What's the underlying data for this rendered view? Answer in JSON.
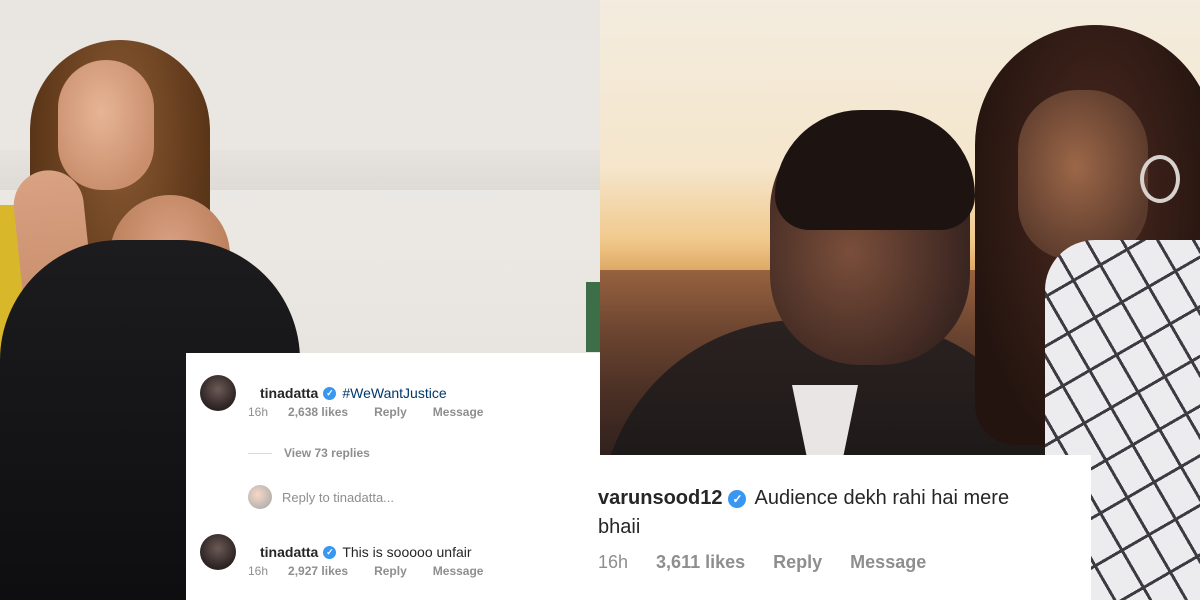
{
  "left_comments": [
    {
      "username": "tinadatta",
      "text": "#WeWantJustice",
      "time": "16h",
      "likes": "2,638 likes",
      "reply": "Reply",
      "message": "Message"
    },
    {
      "username": "tinadatta",
      "text": "This is sooooo unfair",
      "time": "16h",
      "likes": "2,927 likes",
      "reply": "Reply",
      "message": "Message"
    }
  ],
  "view_replies": "View 73 replies",
  "reply_placeholder": "Reply to tinadatta...",
  "right_comment": {
    "username": "varunsood12",
    "text_line1": "Audience dekh rahi hai mere",
    "text_line2": "bhaii",
    "time": "16h",
    "likes": "3,611 likes",
    "reply": "Reply",
    "message": "Message"
  },
  "icons": {
    "verified": "verified-badge-icon"
  },
  "colors": {
    "verified_blue": "#3897f0",
    "hashtag_blue": "#00376b",
    "meta_gray": "#8e8e8e"
  }
}
